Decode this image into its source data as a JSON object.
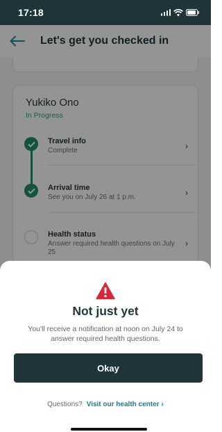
{
  "status_bar": {
    "time": "17:18",
    "icons": [
      "signal-icon",
      "wifi-icon",
      "battery-icon"
    ]
  },
  "header": {
    "title": "Let's get you checked in",
    "back_icon": "back-arrow-icon"
  },
  "guest": {
    "name": "Yukiko Ono",
    "status": "In Progress",
    "steps": [
      {
        "title": "Travel info",
        "subtitle": "Complete",
        "done": true
      },
      {
        "title": "Arrival time",
        "subtitle": "See you on July 26 at 1 p.m.",
        "done": true
      },
      {
        "title": "Health status",
        "subtitle": "Answer required health questions on July 25",
        "done": false
      }
    ]
  },
  "sheet": {
    "icon": "warning-icon",
    "title": "Not just yet",
    "body": "You'll receive a notification at noon on July 24 to answer required health questions.",
    "button_label": "Okay",
    "questions_label": "Questions?",
    "link_label": "Visit our health center"
  },
  "colors": {
    "status_bar": "#1f3439",
    "primary_dark": "#1f3439",
    "accent_teal": "#1a8da1",
    "success_green": "#1f8f62",
    "warning_red": "#d6283a"
  }
}
